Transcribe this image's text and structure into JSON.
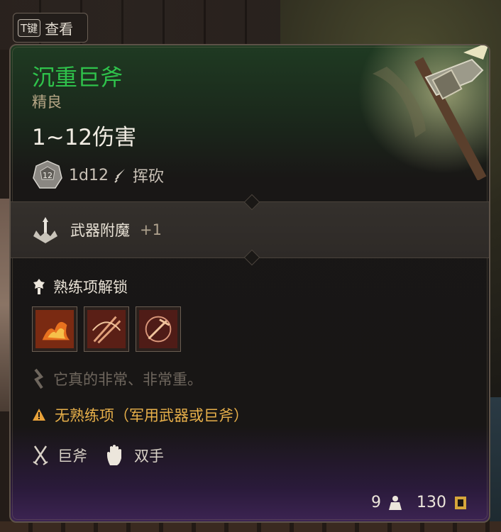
{
  "hotkey": {
    "key": "T键",
    "label": "查看"
  },
  "item": {
    "name": "沉重巨斧",
    "rarity": "精良",
    "damage": "1~12伤害",
    "dice_value": "12",
    "dice_formula": "1d12",
    "damage_type": "挥砍",
    "enchant_label": "武器附魔",
    "enchant_bonus": "+1",
    "proficiency_title": "熟练项解锁",
    "flavor_text": "它真的非常、非常重。",
    "warning_text": "无熟练项（军用武器或巨斧）",
    "weapon_type": "巨斧",
    "handedness": "双手",
    "weight": "9",
    "value": "130"
  },
  "colors": {
    "name": "#2fc24b",
    "warning": "#e8b04a"
  }
}
